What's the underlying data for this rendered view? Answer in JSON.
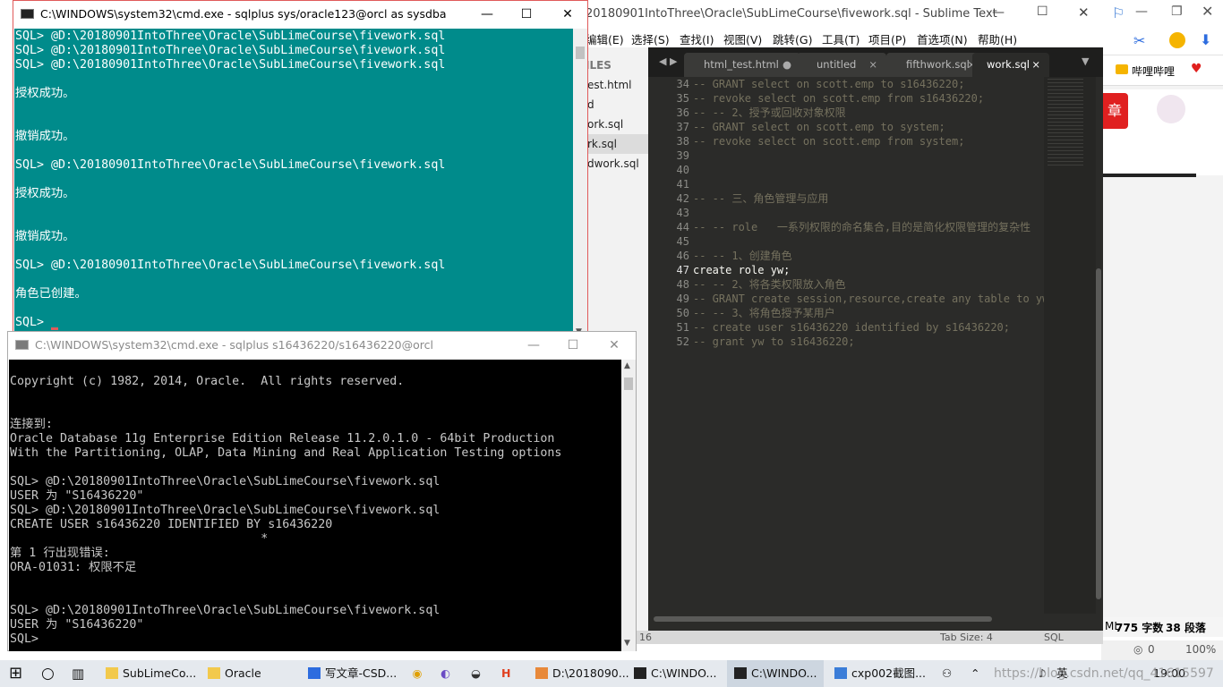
{
  "browser": {
    "bookmark_label": "哔哩哔哩",
    "content_badge": "章",
    "status": {
      "ml": "ML",
      "word_count": "775 字数",
      "paragraphs": "38 段落",
      "comments": "0",
      "zoom": "100%"
    },
    "watermark": "https://blog.csdn.net/qq_41615597"
  },
  "sublime": {
    "title": "20180901IntoThree\\Oracle\\SubLimeCourse\\fivework.sql - Sublime Text",
    "menu": [
      "编辑(E)",
      "选择(S)",
      "查找(I)",
      "视图(V)",
      "跳转(G)",
      "工具(T)",
      "项目(P)",
      "首选项(N)",
      "帮助(H)"
    ],
    "sidebar_header": "ILES",
    "sidebar_files": [
      "est.html",
      "d",
      "ork.sql",
      "rk.sql",
      "dwork.sql"
    ],
    "tabs": [
      {
        "label": "html_test.html",
        "close": "●"
      },
      {
        "label": "untitled",
        "close": "×"
      },
      {
        "label": "fifthwork.sql",
        "close": "×"
      },
      {
        "label": "work.sql",
        "close": "×"
      }
    ],
    "line_numbers": [
      "34",
      "35",
      "36",
      "37",
      "38",
      "39",
      "40",
      "41",
      "42",
      "43",
      "44",
      "45",
      "46",
      "47",
      "48",
      "49",
      "50",
      "51",
      "52"
    ],
    "code_lines": [
      "-- GRANT select on scott.emp to s16436220;",
      "-- revoke select on scott.emp from s16436220;",
      "-- -- 2、授予或回收对象权限",
      "-- GRANT select on scott.emp to system;",
      "-- revoke select on scott.emp from system;",
      "",
      "",
      "",
      "-- -- 三、角色管理与应用",
      "",
      "-- -- role   一系列权限的命名集合,目的是简化权限管理的复杂性",
      "",
      "-- -- 1、创建角色",
      "create role yw;",
      "-- -- 2、将各类权限放入角色",
      "-- GRANT create session,resource,create any table to yw;",
      "-- -- 3、将角色授予某用户",
      "-- create user s16436220 identified by s16436220;",
      "-- grant yw to s16436220;"
    ],
    "status_left": "16",
    "tab_size": "Tab Size: 4",
    "syntax": "SQL"
  },
  "cmd1": {
    "title": "C:\\WINDOWS\\system32\\cmd.exe - sqlplus  sys/oracle123@orcl as sysdba",
    "lines": [
      "SQL> @D:\\20180901IntoThree\\Oracle\\SubLimeCourse\\fivework.sql",
      "SQL> @D:\\20180901IntoThree\\Oracle\\SubLimeCourse\\fivework.sql",
      "SQL> @D:\\20180901IntoThree\\Oracle\\SubLimeCourse\\fivework.sql",
      "",
      "授权成功。",
      "",
      "",
      "撤销成功。",
      "",
      "SQL> @D:\\20180901IntoThree\\Oracle\\SubLimeCourse\\fivework.sql",
      "",
      "授权成功。",
      "",
      "",
      "撤销成功。",
      "",
      "SQL> @D:\\20180901IntoThree\\Oracle\\SubLimeCourse\\fivework.sql",
      "",
      "角色已创建。",
      "",
      "SQL> "
    ]
  },
  "cmd2": {
    "title": "C:\\WINDOWS\\system32\\cmd.exe - sqlplus  s16436220/s16436220@orcl",
    "lines": [
      "",
      "Copyright (c) 1982, 2014, Oracle.  All rights reserved.",
      "",
      "",
      "连接到:",
      "Oracle Database 11g Enterprise Edition Release 11.2.0.1.0 - 64bit Production",
      "With the Partitioning, OLAP, Data Mining and Real Application Testing options",
      "",
      "SQL> @D:\\20180901IntoThree\\Oracle\\SubLimeCourse\\fivework.sql",
      "USER 为 \"S16436220\"",
      "SQL> @D:\\20180901IntoThree\\Oracle\\SubLimeCourse\\fivework.sql",
      "CREATE USER s16436220 IDENTIFIED BY s16436220",
      "                                   *",
      "第 1 行出现错误:",
      "ORA-01031: 权限不足",
      "",
      "",
      "SQL> @D:\\20180901IntoThree\\Oracle\\SubLimeCourse\\fivework.sql",
      "USER 为 \"S16436220\"",
      "SQL>"
    ]
  },
  "taskbar": {
    "items": [
      {
        "label": "SubLimeCo...",
        "color": "#f2c94c"
      },
      {
        "label": "Oracle",
        "color": "#f2c94c"
      },
      {
        "label": "写文章-CSD...",
        "color": "#2d6cdf"
      },
      {
        "label": "D:\\2018090...",
        "color": "#e8893a"
      },
      {
        "label": "C:\\WINDO...",
        "color": "#222222"
      },
      {
        "label": "C:\\WINDO...",
        "color": "#222222"
      },
      {
        "label": "cxp002截图...",
        "color": "#3b7dd8"
      }
    ],
    "tray": {
      "ime": "英",
      "time": "19:00"
    }
  }
}
